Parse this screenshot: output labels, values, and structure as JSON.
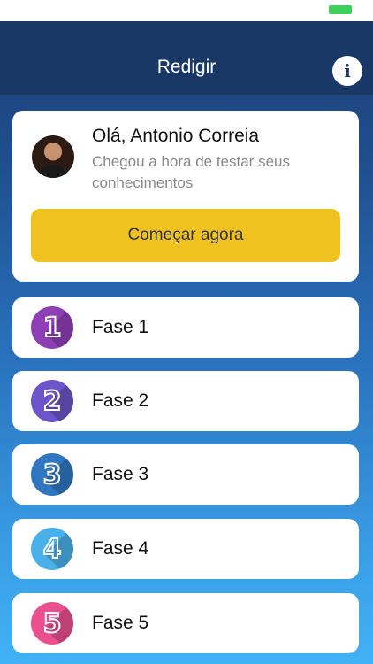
{
  "header": {
    "title": "Redigir",
    "info_icon_glyph": "i"
  },
  "welcome": {
    "greeting": "Olá, Antonio Correia",
    "subtitle": "Chegou a hora de testar seus conhecimentos",
    "button_label": "Começar agora"
  },
  "phases": [
    {
      "number": "1",
      "label": "Fase 1",
      "color": "#8e3fb6"
    },
    {
      "number": "2",
      "label": "Fase 2",
      "color": "#6b55c8"
    },
    {
      "number": "3",
      "label": "Fase 3",
      "color": "#2f76c0"
    },
    {
      "number": "4",
      "label": "Fase 4",
      "color": "#4ab0ea"
    },
    {
      "number": "5",
      "label": "Fase 5",
      "color": "#ea4f8f"
    }
  ],
  "colors": {
    "accent_button": "#efc21f",
    "nav_bg": "#193865",
    "battery": "#3ecf5c"
  }
}
